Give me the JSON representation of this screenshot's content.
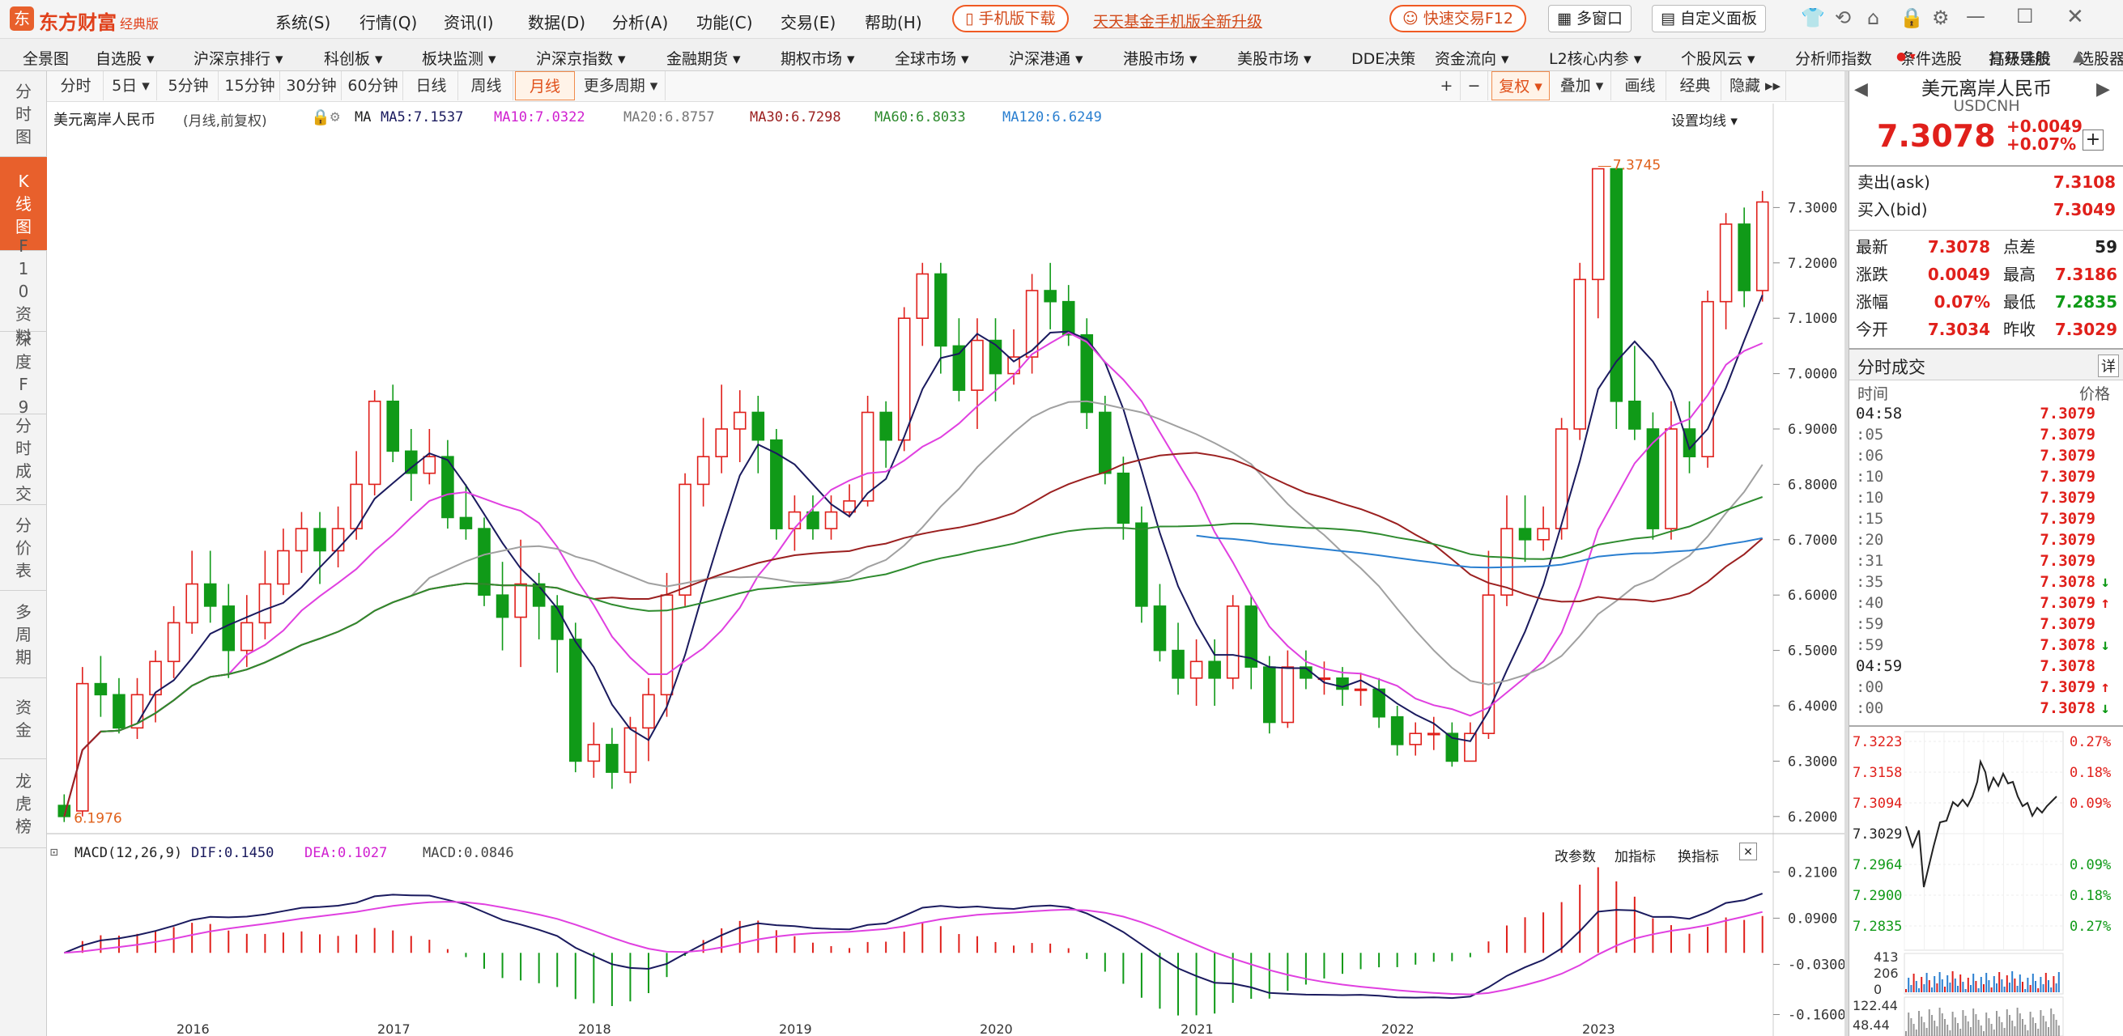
{
  "app": {
    "logo_text": "东方财富",
    "edition": "经典版"
  },
  "menu": [
    "系统(S)",
    "行情(Q)",
    "资讯(I)",
    "数据(D)",
    "分析(A)",
    "功能(C)",
    "交易(E)",
    "帮助(H)"
  ],
  "title_buttons": {
    "mobile_download": "手机版下载",
    "fund_notice": "天天基金手机版全新升级",
    "quick_trade": "快速交易F12",
    "multi_window": "多窗口",
    "custom_panel": "自定义面板"
  },
  "toolbar": [
    "全景图",
    "自选股 ▾",
    "沪深京排行 ▾",
    "科创板 ▾",
    "板块监测 ▾",
    "沪深京指数 ▾",
    "金融期货 ▾",
    "期权市场 ▾",
    "全球市场 ▾",
    "沪深港通 ▾",
    "港股市场 ▾",
    "美股市场 ▾",
    "DDE决策",
    "资金流向 ▾",
    "L2核心内参 ▾",
    "个股风云 ▾",
    "分析师指数",
    "条件选股",
    "高级选股",
    "选股器"
  ],
  "toolbar_right": "打开导航",
  "left_tabs": [
    {
      "label": "分时图",
      "active": false
    },
    {
      "label": "K线图",
      "active": true
    },
    {
      "label": "F10资料",
      "active": false
    },
    {
      "label": "深度F9",
      "active": false
    },
    {
      "label": "分时成交",
      "active": false
    },
    {
      "label": "分价表",
      "active": false
    },
    {
      "label": "多周期",
      "active": false
    },
    {
      "label": "资金",
      "active": false
    },
    {
      "label": "龙虎榜",
      "active": false
    }
  ],
  "periods": [
    {
      "label": "分时",
      "active": false
    },
    {
      "label": "5日 ▾",
      "active": false
    },
    {
      "label": "5分钟",
      "active": false
    },
    {
      "label": "15分钟",
      "active": false
    },
    {
      "label": "30分钟",
      "active": false
    },
    {
      "label": "60分钟",
      "active": false
    },
    {
      "label": "日线",
      "active": false
    },
    {
      "label": "周线",
      "active": false
    },
    {
      "label": "月线",
      "active": true
    },
    {
      "label": "更多周期 ▾",
      "active": false
    }
  ],
  "chart_toolbar": {
    "fuquan": "复权 ▾",
    "overlay": "叠加 ▾",
    "draw": "画线",
    "classic": "经典",
    "hide": "隐藏 ▸▸"
  },
  "legend": {
    "name": "美元离岸人民币",
    "period": "(月线,前复权)",
    "ma_label": "MA",
    "ma5": "MA5:7.1537",
    "ma10": "MA10:7.0322",
    "ma20": "MA20:6.8757",
    "ma30": "MA30:6.7298",
    "ma60": "MA60:6.8033",
    "ma120": "MA120:6.6249",
    "settings": "设置均线 ▾"
  },
  "macd_legend": {
    "label": "MACD(12,26,9)",
    "dif": "DIF:0.1450",
    "dea": "DEA:0.1027",
    "macd": "MACD:0.0846",
    "change_params": "改参数",
    "add_indicator": "加指标",
    "switch_indicator": "换指标"
  },
  "colors": {
    "up": "#e0201b",
    "down": "#109a18",
    "ma5": "#1a1a5e",
    "ma10": "#e040e0",
    "ma20": "#a0a0a0",
    "ma30": "#9b2020",
    "ma60": "#2e8b2e",
    "ma120": "#2a7fd0",
    "accent": "#e8602c"
  },
  "price_axis": [
    "7.3000",
    "7.2000",
    "7.1000",
    "7.0000",
    "6.9000",
    "6.8000",
    "6.7000",
    "6.6000",
    "6.5000",
    "6.4000",
    "6.3000",
    "6.2000"
  ],
  "macd_axis": [
    "0.2100",
    "0.0900",
    "-0.0300",
    "-0.1600"
  ],
  "x_axis": [
    "2016",
    "2017",
    "2018",
    "2019",
    "2020",
    "2021",
    "2022",
    "2023"
  ],
  "annotations": {
    "high": "7.3745",
    "low": "6.1976"
  },
  "chart_data": {
    "type": "candlestick",
    "title": "美元离岸人民币 (月线,前复权)",
    "ylim": [
      6.15,
      7.4
    ],
    "high_marker": 7.3745,
    "low_marker": 6.1976,
    "candles": [
      [
        6.22,
        6.2,
        6.24,
        6.19
      ],
      [
        6.21,
        6.44,
        6.47,
        6.2
      ],
      [
        6.44,
        6.42,
        6.49,
        6.38
      ],
      [
        6.42,
        6.36,
        6.45,
        6.35
      ],
      [
        6.36,
        6.42,
        6.45,
        6.34
      ],
      [
        6.42,
        6.48,
        6.5,
        6.37
      ],
      [
        6.48,
        6.55,
        6.58,
        6.45
      ],
      [
        6.55,
        6.62,
        6.68,
        6.53
      ],
      [
        6.62,
        6.58,
        6.68,
        6.55
      ],
      [
        6.58,
        6.5,
        6.62,
        6.45
      ],
      [
        6.5,
        6.55,
        6.6,
        6.47
      ],
      [
        6.55,
        6.62,
        6.68,
        6.52
      ],
      [
        6.62,
        6.68,
        6.72,
        6.6
      ],
      [
        6.68,
        6.72,
        6.75,
        6.64
      ],
      [
        6.72,
        6.68,
        6.75,
        6.62
      ],
      [
        6.68,
        6.72,
        6.76,
        6.65
      ],
      [
        6.72,
        6.8,
        6.86,
        6.7
      ],
      [
        6.8,
        6.95,
        6.97,
        6.78
      ],
      [
        6.95,
        6.86,
        6.98,
        6.84
      ],
      [
        6.86,
        6.82,
        6.9,
        6.77
      ],
      [
        6.82,
        6.85,
        6.9,
        6.8
      ],
      [
        6.85,
        6.74,
        6.88,
        6.72
      ],
      [
        6.74,
        6.72,
        6.8,
        6.7
      ],
      [
        6.72,
        6.6,
        6.74,
        6.58
      ],
      [
        6.6,
        6.56,
        6.66,
        6.5
      ],
      [
        6.56,
        6.62,
        6.7,
        6.47
      ],
      [
        6.62,
        6.58,
        6.64,
        6.52
      ],
      [
        6.58,
        6.52,
        6.6,
        6.46
      ],
      [
        6.52,
        6.3,
        6.55,
        6.28
      ],
      [
        6.3,
        6.33,
        6.37,
        6.27
      ],
      [
        6.33,
        6.28,
        6.36,
        6.25
      ],
      [
        6.28,
        6.36,
        6.38,
        6.26
      ],
      [
        6.36,
        6.42,
        6.45,
        6.3
      ],
      [
        6.42,
        6.6,
        6.64,
        6.38
      ],
      [
        6.6,
        6.8,
        6.82,
        6.58
      ],
      [
        6.8,
        6.85,
        6.92,
        6.76
      ],
      [
        6.85,
        6.9,
        6.98,
        6.82
      ],
      [
        6.9,
        6.93,
        6.97,
        6.84
      ],
      [
        6.93,
        6.88,
        6.96,
        6.82
      ],
      [
        6.88,
        6.72,
        6.9,
        6.7
      ],
      [
        6.72,
        6.75,
        6.78,
        6.68
      ],
      [
        6.75,
        6.72,
        6.78,
        6.7
      ],
      [
        6.72,
        6.75,
        6.78,
        6.7
      ],
      [
        6.75,
        6.77,
        6.8,
        6.74
      ],
      [
        6.77,
        6.93,
        6.96,
        6.76
      ],
      [
        6.93,
        6.88,
        6.95,
        6.83
      ],
      [
        6.88,
        7.1,
        7.12,
        6.86
      ],
      [
        7.1,
        7.18,
        7.2,
        7.05
      ],
      [
        7.18,
        7.05,
        7.2,
        7.0
      ],
      [
        7.05,
        6.97,
        7.1,
        6.95
      ],
      [
        6.97,
        7.06,
        7.1,
        6.9
      ],
      [
        7.06,
        7.0,
        7.1,
        6.95
      ],
      [
        7.0,
        7.03,
        7.08,
        6.98
      ],
      [
        7.03,
        7.15,
        7.18,
        7.0
      ],
      [
        7.15,
        7.13,
        7.2,
        7.08
      ],
      [
        7.13,
        7.07,
        7.16,
        7.05
      ],
      [
        7.07,
        6.93,
        7.1,
        6.9
      ],
      [
        6.93,
        6.82,
        6.96,
        6.8
      ],
      [
        6.82,
        6.73,
        6.85,
        6.7
      ],
      [
        6.73,
        6.58,
        6.76,
        6.55
      ],
      [
        6.58,
        6.5,
        6.62,
        6.48
      ],
      [
        6.5,
        6.45,
        6.55,
        6.42
      ],
      [
        6.45,
        6.48,
        6.52,
        6.4
      ],
      [
        6.48,
        6.45,
        6.52,
        6.4
      ],
      [
        6.45,
        6.58,
        6.6,
        6.43
      ],
      [
        6.58,
        6.47,
        6.6,
        6.43
      ],
      [
        6.47,
        6.37,
        6.49,
        6.35
      ],
      [
        6.37,
        6.47,
        6.5,
        6.36
      ],
      [
        6.47,
        6.45,
        6.5,
        6.43
      ],
      [
        6.45,
        6.45,
        6.48,
        6.42
      ],
      [
        6.45,
        6.43,
        6.47,
        6.4
      ],
      [
        6.43,
        6.43,
        6.46,
        6.4
      ],
      [
        6.43,
        6.38,
        6.45,
        6.36
      ],
      [
        6.38,
        6.33,
        6.4,
        6.31
      ],
      [
        6.33,
        6.35,
        6.37,
        6.31
      ],
      [
        6.35,
        6.35,
        6.38,
        6.32
      ],
      [
        6.35,
        6.3,
        6.37,
        6.29
      ],
      [
        6.3,
        6.35,
        6.37,
        6.3
      ],
      [
        6.35,
        6.6,
        6.68,
        6.34
      ],
      [
        6.6,
        6.72,
        6.78,
        6.58
      ],
      [
        6.72,
        6.7,
        6.78,
        6.66
      ],
      [
        6.7,
        6.72,
        6.76,
        6.68
      ],
      [
        6.72,
        6.9,
        6.92,
        6.7
      ],
      [
        6.9,
        7.17,
        7.2,
        6.88
      ],
      [
        7.17,
        7.37,
        7.37,
        7.1
      ],
      [
        7.37,
        6.95,
        7.37,
        6.9
      ],
      [
        6.95,
        6.9,
        7.05,
        6.88
      ],
      [
        6.9,
        6.72,
        6.93,
        6.7
      ],
      [
        6.72,
        6.9,
        6.95,
        6.7
      ],
      [
        6.9,
        6.85,
        6.95,
        6.82
      ],
      [
        6.85,
        7.13,
        7.15,
        6.83
      ],
      [
        7.13,
        7.27,
        7.29,
        7.08
      ],
      [
        7.27,
        7.15,
        7.3,
        7.12
      ],
      [
        7.15,
        7.31,
        7.33,
        7.13
      ]
    ],
    "ma_series": {
      "MA5": 7.1537,
      "MA10": 7.0322,
      "MA20": 6.8757,
      "MA30": 6.7298,
      "MA60": 6.8033,
      "MA120": 6.6249
    },
    "macd": {
      "dif": 0.145,
      "dea": 0.1027,
      "macd": 0.0846,
      "ylim": [
        -0.18,
        0.24
      ]
    }
  },
  "quote": {
    "name": "美元离岸人民币",
    "code": "USDCNH",
    "price": "7.3078",
    "change": "+0.0049",
    "pct": "+0.07%",
    "ask_label": "卖出(ask)",
    "ask": "7.3108",
    "bid_label": "买入(bid)",
    "bid": "7.3049",
    "rows": [
      [
        "最新",
        "7.3078",
        "点差",
        "59"
      ],
      [
        "涨跌",
        "0.0049",
        "最高",
        "7.3186"
      ],
      [
        "涨幅",
        "0.07%",
        "最低",
        "7.2835"
      ],
      [
        "今开",
        "7.3034",
        "昨收",
        "7.3029"
      ]
    ]
  },
  "ticks_header": {
    "title": "分时成交",
    "detail": "详",
    "time_col": "时间",
    "price_col": "价格"
  },
  "ticks": [
    [
      "04:58",
      "7.3079",
      ""
    ],
    [
      ":05",
      "7.3079",
      ""
    ],
    [
      ":06",
      "7.3079",
      ""
    ],
    [
      ":10",
      "7.3079",
      ""
    ],
    [
      ":10",
      "7.3079",
      ""
    ],
    [
      ":15",
      "7.3079",
      ""
    ],
    [
      ":20",
      "7.3079",
      ""
    ],
    [
      ":31",
      "7.3079",
      ""
    ],
    [
      ":35",
      "7.3078",
      "↓"
    ],
    [
      ":40",
      "7.3079",
      "↑"
    ],
    [
      ":59",
      "7.3079",
      ""
    ],
    [
      ":59",
      "7.3078",
      "↓"
    ],
    [
      "04:59",
      "7.3078",
      ""
    ],
    [
      ":00",
      "7.3079",
      "↑"
    ],
    [
      ":00",
      "7.3078",
      "↓"
    ]
  ],
  "mini_chart": {
    "left_axis": [
      "7.3223",
      "7.3158",
      "7.3094",
      "7.3029",
      "7.2964",
      "7.2900",
      "7.2835"
    ],
    "right_axis": [
      "0.27%",
      "0.18%",
      "0.09%",
      "",
      "0.09%",
      "0.18%",
      "0.27%"
    ],
    "vol_axis": [
      "413",
      "206",
      "0"
    ],
    "ind_axis": [
      "122.44",
      "48.44"
    ]
  }
}
